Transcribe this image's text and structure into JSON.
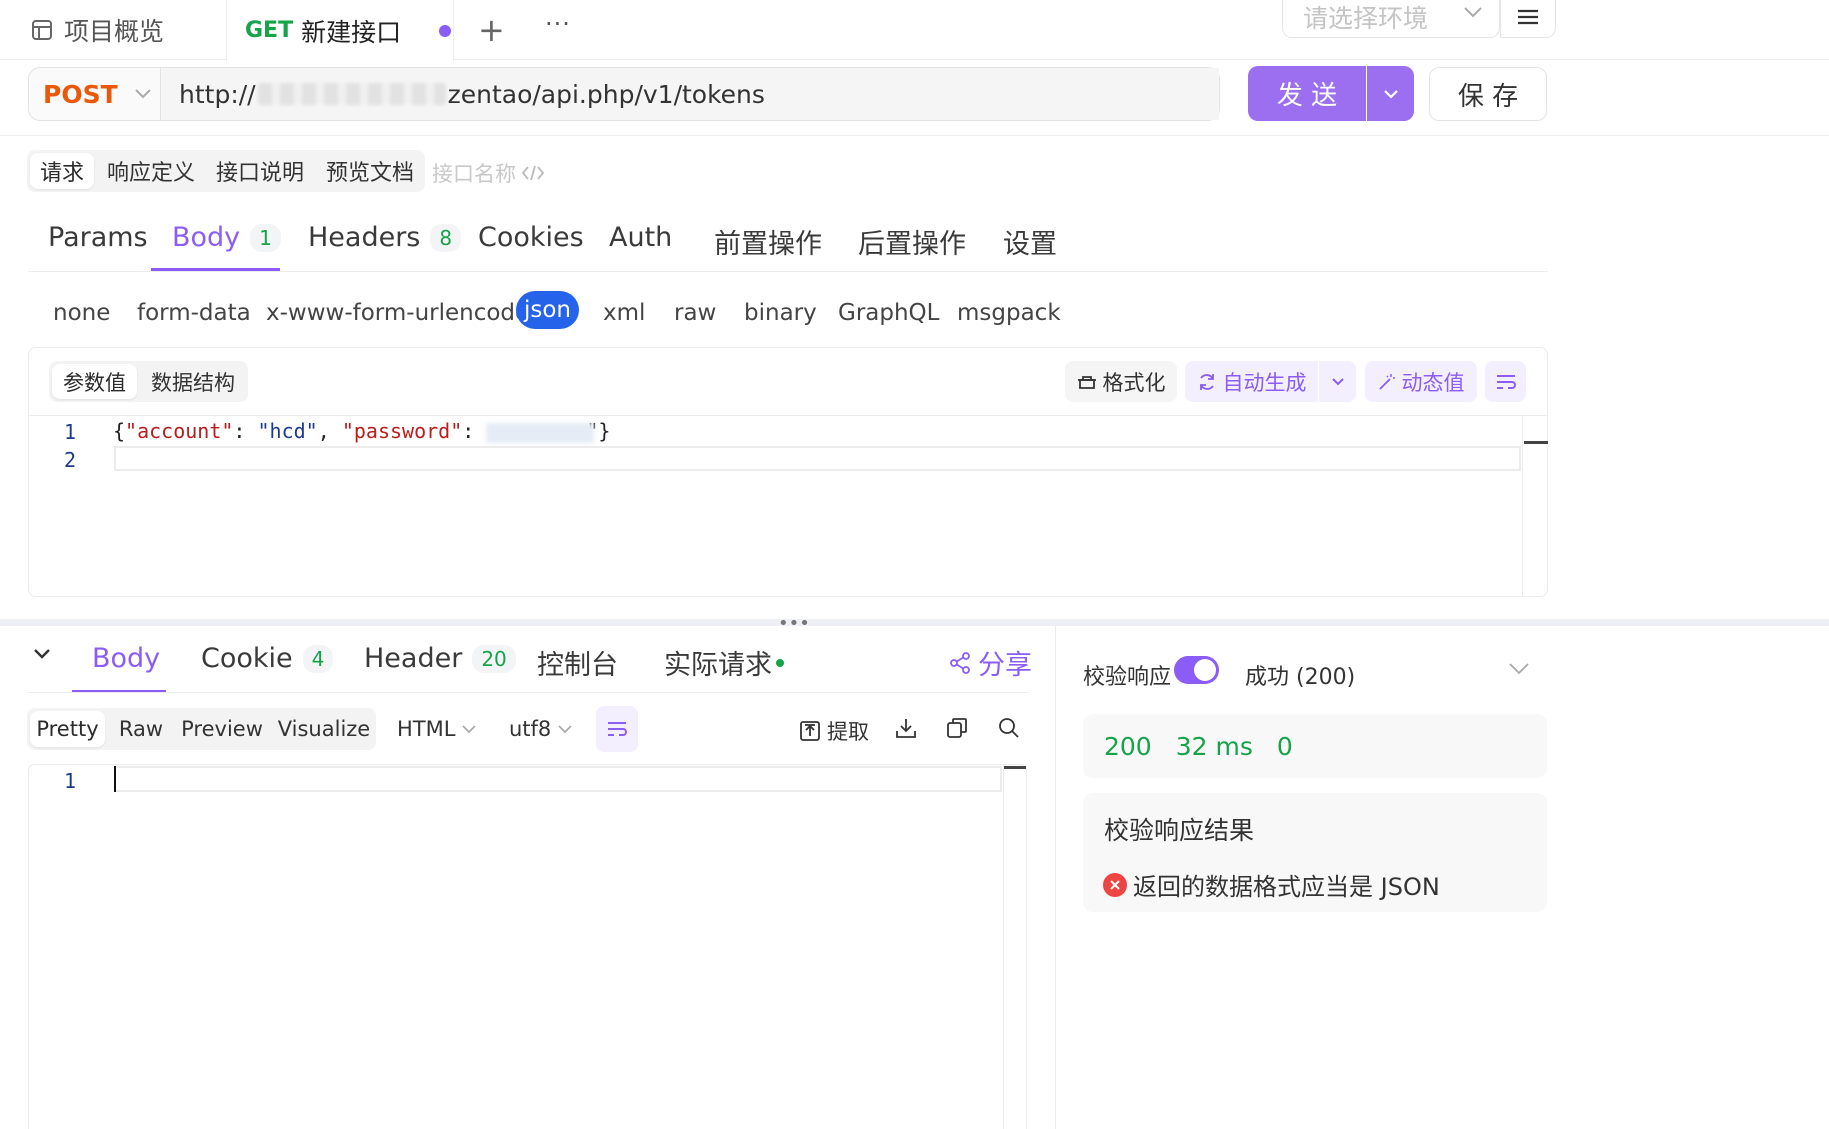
{
  "top_tabs": {
    "overview": "项目概览",
    "active_method": "GET",
    "active_name": "新建接口",
    "plus": "+",
    "more": "···"
  },
  "env": {
    "placeholder": "请选择环境"
  },
  "url_bar": {
    "method": "POST",
    "url_prefix": "http://",
    "url_suffix": "zentao/api.php/v1/tokens",
    "send": "发 送",
    "save": "保 存"
  },
  "doc_tabs": [
    "请求",
    "响应定义",
    "接口说明",
    "预览文档"
  ],
  "name_placeholder": "接口名称",
  "req_tabs": [
    {
      "label": "Params"
    },
    {
      "label": "Body",
      "count": "1"
    },
    {
      "label": "Headers",
      "count": "8"
    },
    {
      "label": "Cookies"
    },
    {
      "label": "Auth"
    },
    {
      "label": "前置操作"
    },
    {
      "label": "后置操作"
    },
    {
      "label": "设置"
    }
  ],
  "body_types": [
    "none",
    "form-data",
    "x-www-form-urlencoded",
    "json",
    "xml",
    "raw",
    "binary",
    "GraphQL",
    "msgpack"
  ],
  "body_toggle": [
    "参数值",
    "数据结构"
  ],
  "editor_tools": {
    "format": "格式化",
    "auto": "自动生成",
    "dynamic": "动态值"
  },
  "code": {
    "line1": "1",
    "line2": "2",
    "open": "{",
    "k1": "\"account\"",
    "colon1": ": ",
    "v1": "\"hcd\"",
    "comma": ", ",
    "k2": "\"password\"",
    "colon2": ": ",
    "close": "\"}"
  },
  "resp_tabs": [
    {
      "label": "Body"
    },
    {
      "label": "Cookie",
      "count": "4"
    },
    {
      "label": "Header",
      "count": "20"
    },
    {
      "label": "控制台"
    },
    {
      "label": "实际请求"
    }
  ],
  "share": "分享",
  "resp_view": [
    "Pretty",
    "Raw",
    "Preview",
    "Visualize"
  ],
  "resp_format": "HTML",
  "resp_encoding": "utf8",
  "extract": "提取",
  "resp_line": "1",
  "validate": {
    "label": "校验响应",
    "status": "成功 (200)",
    "code": "200",
    "time": "32 ms",
    "size": "0",
    "result_title": "校验响应结果",
    "error": "返回的数据格式应当是 JSON"
  },
  "colors": {
    "accent": "#8b5cf6",
    "post": "#ea580c",
    "get": "#16a34a",
    "success": "#16a34a",
    "error": "#ef4444",
    "string": "#b91c1c",
    "json_active": "#2563eb"
  }
}
